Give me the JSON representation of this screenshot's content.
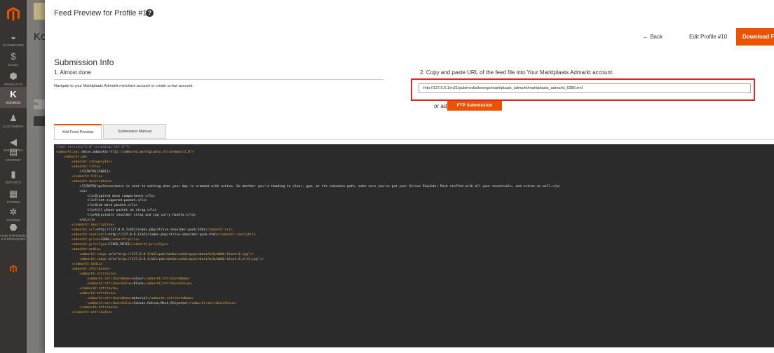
{
  "sidebar": {
    "items": [
      {
        "icon": "dashboard-icon",
        "label": "DASHBOARD"
      },
      {
        "icon": "dollar-icon",
        "label": "SALES"
      },
      {
        "icon": "box-icon",
        "label": "PRODUCTS"
      },
      {
        "icon": "koongo-icon",
        "label": "KOONGO"
      },
      {
        "icon": "person-icon",
        "label": "CUSTOMERS"
      },
      {
        "icon": "megaphone-icon",
        "label": "MARKETING"
      },
      {
        "icon": "content-icon",
        "label": "CONTENT"
      },
      {
        "icon": "bar-chart-icon",
        "label": "REPORTS"
      },
      {
        "icon": "store-icon",
        "label": "STORES"
      },
      {
        "icon": "gear-icon",
        "label": "SYSTEM"
      },
      {
        "icon": "cube-icon",
        "label": "FIND PARTNERS & EXTENSIONS"
      }
    ]
  },
  "background_page": {
    "title_fragment": "Ko",
    "button_fragment": "Ac"
  },
  "modal": {
    "title": "Feed Preview for Profile #10",
    "help": "?",
    "actions": {
      "back": "← Back",
      "edit": "Edit Profile #10",
      "download": "Download Fil"
    },
    "submission_info": "Submission Info",
    "step1_title": "1. Almost done",
    "step1_text": "Navigate to your Marktplaats Admarkt merchant account or create a new account.",
    "step2_title": "2. Copy and paste URL of the feed file into Your Marktplaats Admarkt account.",
    "feed_url": "http://127.0.0.1/m21/pub/media/koongo/marktplaats_admarkt/marktplaats_admarkt_6386.xml",
    "or_adjust": "or adjust",
    "ftp_button": "FTP Submission",
    "tabs": [
      {
        "label": "Xml Feed Preview",
        "active": true
      },
      {
        "label": "Submission Manual",
        "active": false
      }
    ]
  },
  "colors": {
    "accent": "#eb5202",
    "highlight_border": "#e22626",
    "sidebar_bg": "#373330",
    "code_bg": "#2b2b2b",
    "code_tag": "#e8a237"
  }
}
